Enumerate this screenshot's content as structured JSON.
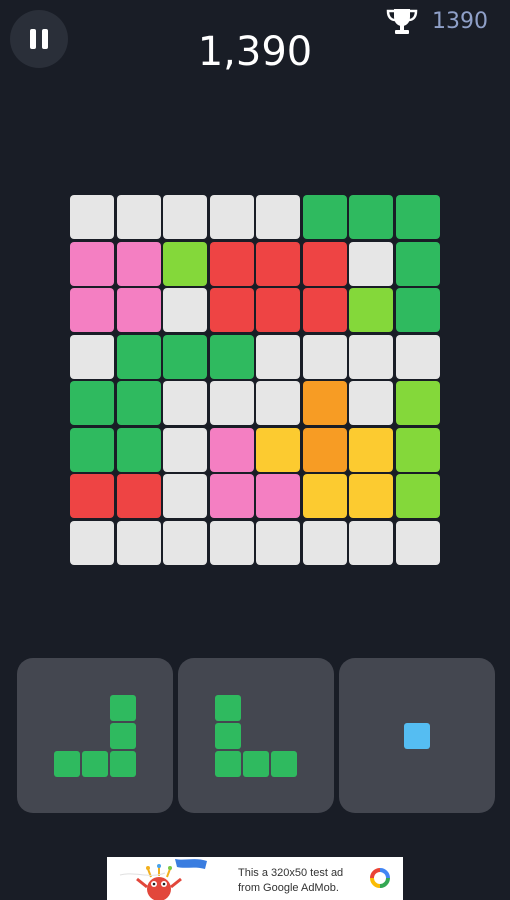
{
  "hud": {
    "score": "1,390",
    "best_score": "1390",
    "pause_icon": "pause-icon",
    "trophy_icon": "trophy-icon"
  },
  "colors": {
    "background": "#191d26",
    "empty": "#e6e6e6",
    "green": "#2fba5f",
    "pink": "#f47fc2",
    "lime": "#84d83a",
    "red": "#ee4444",
    "orange": "#f79c24",
    "yellow": "#fccb30",
    "blue": "#55bdf2",
    "tray": "#444750"
  },
  "board": {
    "rows": 8,
    "cols": 8,
    "grid": [
      [
        "E",
        "E",
        "E",
        "E",
        "E",
        "G",
        "G",
        "G"
      ],
      [
        "P",
        "P",
        "L",
        "R",
        "R",
        "R",
        "E",
        "G"
      ],
      [
        "P",
        "P",
        "E",
        "R",
        "R",
        "R",
        "L",
        "G"
      ],
      [
        "E",
        "G",
        "G",
        "G",
        "E",
        "E",
        "E",
        "E"
      ],
      [
        "G",
        "G",
        "E",
        "E",
        "E",
        "O",
        "E",
        "L"
      ],
      [
        "G",
        "G",
        "E",
        "P",
        "Y",
        "O",
        "Y",
        "L"
      ],
      [
        "R",
        "R",
        "E",
        "P",
        "P",
        "Y",
        "Y",
        "L"
      ],
      [
        "E",
        "E",
        "E",
        "E",
        "E",
        "E",
        "E",
        "E"
      ]
    ]
  },
  "pieces": [
    {
      "name": "j-piece",
      "color": "green",
      "cells": [
        [
          0,
          2
        ],
        [
          1,
          2
        ],
        [
          2,
          0
        ],
        [
          2,
          1
        ],
        [
          2,
          2
        ]
      ]
    },
    {
      "name": "l-piece",
      "color": "green",
      "cells": [
        [
          0,
          0
        ],
        [
          1,
          0
        ],
        [
          2,
          0
        ],
        [
          2,
          1
        ],
        [
          2,
          2
        ]
      ]
    },
    {
      "name": "single-piece",
      "color": "blue",
      "cells": [
        [
          0,
          0
        ]
      ]
    }
  ],
  "ad": {
    "line1": "This a 320x50 test ad",
    "line2": "from Google AdMob.",
    "logo_icon": "admob-logo-icon"
  }
}
